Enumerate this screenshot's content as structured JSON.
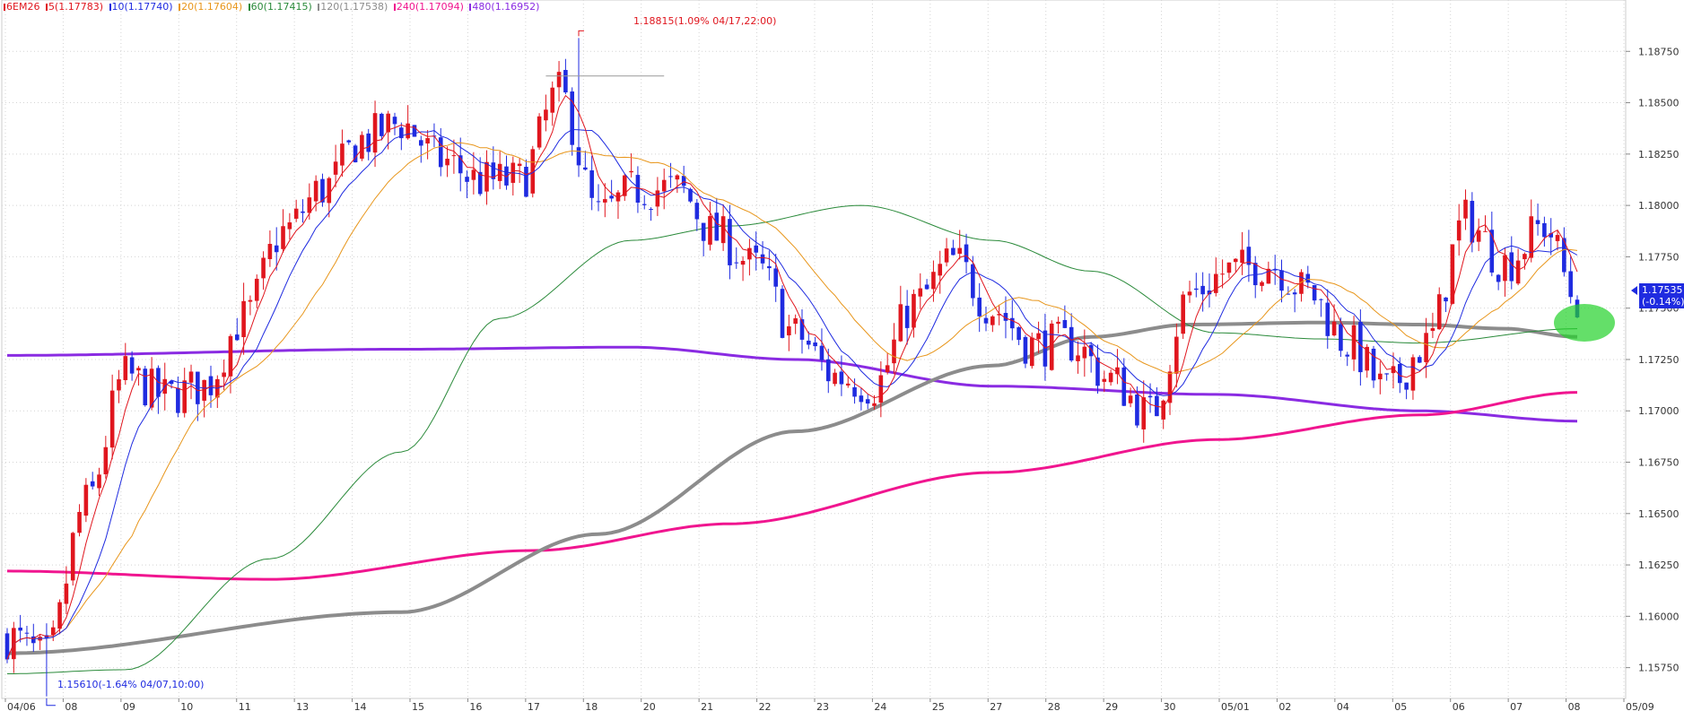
{
  "legend": {
    "symbol": "6EM26",
    "items": [
      {
        "label": "5(1.17783)",
        "color": "#e0161e"
      },
      {
        "label": "10(1.17740)",
        "color": "#1f2be0"
      },
      {
        "label": "20(1.17604)",
        "color": "#e8961b"
      },
      {
        "label": "60(1.17415)",
        "color": "#2a8a3a"
      },
      {
        "label": "120(1.17538)",
        "color": "#8c8c8c"
      },
      {
        "label": "240(1.17094)",
        "color": "#f0158f"
      },
      {
        "label": "480(1.16952)",
        "color": "#8a2be2"
      }
    ]
  },
  "annotations": {
    "high_label": "1.18815(1.09% 04/17,22:00)",
    "low_label": "1.15610(-1.64% 04/07,10:00)"
  },
  "price_tag": {
    "price": "1.17535",
    "change": "(-0.14%)"
  },
  "colors": {
    "up": "#e0161e",
    "down": "#1f2be0",
    "ma5": "#e0161e",
    "ma10": "#1f2be0",
    "ma20": "#e8961b",
    "ma60": "#2a8a3a",
    "ma120": "#8c8c8c",
    "ma240": "#f0158f",
    "ma480": "#8a2be2",
    "highlight": "#22d22a"
  },
  "chart_data": {
    "type": "candlestick",
    "title": "6EM26",
    "ylim": [
      1.156,
      1.19
    ],
    "y_ticks": [
      "1.15750",
      "1.16000",
      "1.16250",
      "1.16500",
      "1.16750",
      "1.17000",
      "1.17250",
      "1.17500",
      "1.17750",
      "1.18000",
      "1.18250",
      "1.18500",
      "1.18750"
    ],
    "x_ticks": [
      "04/06",
      "08",
      "09",
      "10",
      "11",
      "13",
      "14",
      "15",
      "16",
      "17",
      "18",
      "20",
      "21",
      "22",
      "23",
      "24",
      "25",
      "27",
      "28",
      "29",
      "30",
      "05/01",
      "02",
      "04",
      "05",
      "06",
      "07",
      "08",
      "05/09"
    ],
    "anchors": [
      {
        "i": 0,
        "y": 1.159
      },
      {
        "i": 6,
        "y": 1.158
      },
      {
        "i": 12,
        "y": 1.1655
      },
      {
        "i": 18,
        "y": 1.1717
      },
      {
        "i": 24,
        "y": 1.1707
      },
      {
        "i": 30,
        "y": 1.1712
      },
      {
        "i": 36,
        "y": 1.1745
      },
      {
        "i": 42,
        "y": 1.1787
      },
      {
        "i": 48,
        "y": 1.1808
      },
      {
        "i": 54,
        "y": 1.1832
      },
      {
        "i": 60,
        "y": 1.184
      },
      {
        "i": 66,
        "y": 1.1822
      },
      {
        "i": 72,
        "y": 1.1812
      },
      {
        "i": 78,
        "y": 1.1812
      },
      {
        "i": 84,
        "y": 1.1855
      },
      {
        "i": 90,
        "y": 1.1795
      },
      {
        "i": 96,
        "y": 1.1808
      },
      {
        "i": 102,
        "y": 1.1808
      },
      {
        "i": 108,
        "y": 1.1785
      },
      {
        "i": 114,
        "y": 1.177
      },
      {
        "i": 120,
        "y": 1.1737
      },
      {
        "i": 126,
        "y": 1.1717
      },
      {
        "i": 132,
        "y": 1.1712
      },
      {
        "i": 138,
        "y": 1.1752
      },
      {
        "i": 144,
        "y": 1.1773
      },
      {
        "i": 150,
        "y": 1.175
      },
      {
        "i": 156,
        "y": 1.1732
      },
      {
        "i": 162,
        "y": 1.1733
      },
      {
        "i": 168,
        "y": 1.1715
      },
      {
        "i": 174,
        "y": 1.1698
      },
      {
        "i": 180,
        "y": 1.1757
      },
      {
        "i": 186,
        "y": 1.1768
      },
      {
        "i": 192,
        "y": 1.1772
      },
      {
        "i": 198,
        "y": 1.1758
      },
      {
        "i": 204,
        "y": 1.1733
      },
      {
        "i": 210,
        "y": 1.171
      },
      {
        "i": 216,
        "y": 1.1732
      },
      {
        "i": 222,
        "y": 1.1793
      },
      {
        "i": 228,
        "y": 1.1772
      },
      {
        "i": 234,
        "y": 1.179
      },
      {
        "i": 239,
        "y": 1.1754
      }
    ],
    "ma_smooth": {
      "ma120": [
        [
          0,
          1.1582
        ],
        [
          60,
          1.1602
        ],
        [
          90,
          1.164
        ],
        [
          120,
          1.169
        ],
        [
          150,
          1.1722
        ],
        [
          165,
          1.1736
        ],
        [
          180,
          1.1742
        ],
        [
          200,
          1.1743
        ],
        [
          215,
          1.1742
        ],
        [
          228,
          1.174
        ],
        [
          239,
          1.1736
        ]
      ],
      "ma240": [
        [
          0,
          1.1622
        ],
        [
          40,
          1.1618
        ],
        [
          80,
          1.1632
        ],
        [
          110,
          1.1645
        ],
        [
          150,
          1.167
        ],
        [
          184,
          1.1686
        ],
        [
          215,
          1.1698
        ],
        [
          239,
          1.1709
        ]
      ],
      "ma480": [
        [
          0,
          1.1727
        ],
        [
          60,
          1.173
        ],
        [
          95,
          1.1731
        ],
        [
          120,
          1.1725
        ],
        [
          150,
          1.1712
        ],
        [
          184,
          1.1708
        ],
        [
          215,
          1.17
        ],
        [
          239,
          1.1695
        ]
      ],
      "ma60": [
        [
          0,
          1.1572
        ],
        [
          18,
          1.1574
        ],
        [
          40,
          1.1628
        ],
        [
          60,
          1.168
        ],
        [
          75,
          1.1745
        ],
        [
          95,
          1.1783
        ],
        [
          110,
          1.179
        ],
        [
          130,
          1.18
        ],
        [
          150,
          1.1783
        ],
        [
          165,
          1.1768
        ],
        [
          184,
          1.1738
        ],
        [
          200,
          1.1735
        ],
        [
          215,
          1.1733
        ],
        [
          239,
          1.174
        ]
      ]
    }
  }
}
